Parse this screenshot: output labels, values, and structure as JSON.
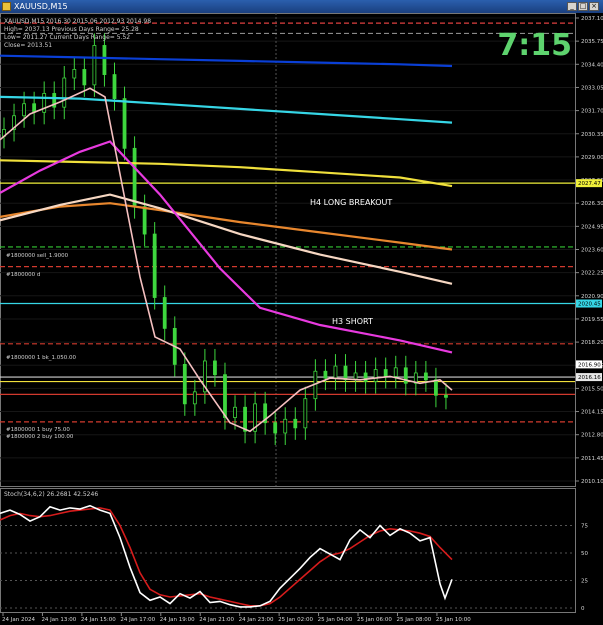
{
  "window": {
    "title": "XAUUSD,M15",
    "buttons": [
      "_",
      "□",
      "×"
    ]
  },
  "overlay": {
    "clock": "7:15",
    "info_lines": [
      "XAUUSD,M15 2016.30 2015.06 2012.93 2014.98",
      "High= 2037.13   Previous Days Range= 25.28",
      "Low= 2011.27   Current Days Range= 5.52",
      "Close= 2013.51"
    ]
  },
  "annotations": {
    "h4": "H4 LONG BREAKOUT",
    "h3": "H3 SHORT",
    "tags": [
      "#1800000 sell_1.9000",
      "#1800000 d",
      "#1800000 1 bk_1.050.00",
      "#1800000 1 buy 75.00",
      "#1800000 2 buy 100.00"
    ]
  },
  "price_axis": {
    "ticks": [
      "2037.10",
      "2035.75",
      "2034.40",
      "2033.05",
      "2031.70",
      "2030.35",
      "2029.00",
      "2027.65",
      "2026.30",
      "2024.95",
      "2023.60",
      "2022.25",
      "2020.90",
      "2019.55",
      "2018.20",
      "2016.85",
      "2015.50",
      "2014.15",
      "2012.80",
      "2011.45",
      "2010.10"
    ],
    "flags": {
      "h4": "2027.47",
      "h3": "2020.45",
      "current_a": "2016.16",
      "current_b": "2016.90"
    }
  },
  "stoch_axis": {
    "label": "Stoch(34,6,2) 26.2681 42.5246",
    "ticks": [
      "75",
      "50",
      "25",
      "0"
    ]
  },
  "time_axis": {
    "labels": [
      "24 Jan 2024",
      "24 Jan 13:00",
      "24 Jan 15:00",
      "24 Jan 17:00",
      "24 Jan 19:00",
      "24 Jan 21:00",
      "24 Jan 23:00",
      "25 Jan 02:00",
      "25 Jan 04:00",
      "25 Jan 06:00",
      "25 Jan 08:00",
      "25 Jan 10:00"
    ]
  },
  "chart_data": [
    {
      "type": "line",
      "title": "XAUUSD,M15",
      "ylim": [
        2010.1,
        2037.1
      ],
      "series": [
        {
          "color": "#0a3fd6",
          "x": [
            0,
            80,
            160,
            240,
            320,
            400,
            452
          ],
          "values": [
            2034.9,
            2034.8,
            2034.7,
            2034.6,
            2034.5,
            2034.4,
            2034.3
          ]
        },
        {
          "color": "#36d6e6",
          "x": [
            0,
            80,
            160,
            240,
            320,
            400,
            452
          ],
          "values": [
            2032.5,
            2032.4,
            2032.1,
            2031.8,
            2031.5,
            2031.2,
            2031.0
          ]
        },
        {
          "color": "#f0e03c",
          "x": [
            0,
            80,
            160,
            240,
            320,
            400,
            452
          ],
          "values": [
            2028.8,
            2028.7,
            2028.6,
            2028.4,
            2028.1,
            2027.8,
            2027.3
          ]
        },
        {
          "color": "#e8872e",
          "x": [
            0,
            60,
            110,
            160,
            240,
            320,
            400,
            452
          ],
          "values": [
            2025.5,
            2026.1,
            2026.3,
            2025.9,
            2025.2,
            2024.6,
            2024.0,
            2023.6
          ]
        },
        {
          "color": "#f6d7c2",
          "x": [
            0,
            60,
            110,
            160,
            240,
            320,
            400,
            452
          ],
          "values": [
            2025.3,
            2026.2,
            2026.8,
            2026.0,
            2024.5,
            2023.3,
            2022.3,
            2021.6
          ]
        },
        {
          "color": "#e83adf",
          "x": [
            0,
            40,
            80,
            110,
            160,
            220,
            260,
            320,
            400,
            452
          ],
          "values": [
            2026.9,
            2028.2,
            2029.3,
            2029.9,
            2026.8,
            2022.5,
            2020.2,
            2019.2,
            2018.3,
            2017.6
          ]
        },
        {
          "color": "#f5c0c0",
          "x": [
            0,
            30,
            60,
            90,
            105,
            120,
            140,
            155,
            180,
            200,
            230,
            250,
            270,
            300,
            330,
            360,
            390,
            420,
            440,
            452
          ],
          "values": [
            2030.0,
            2031.5,
            2032.2,
            2033.0,
            2032.5,
            2028.0,
            2022.0,
            2018.5,
            2017.8,
            2016.0,
            2013.5,
            2013.0,
            2013.9,
            2015.4,
            2016.1,
            2016.0,
            2016.2,
            2015.8,
            2016.0,
            2015.4
          ]
        }
      ],
      "candles_close": [
        2030.6,
        2031.4,
        2032.1,
        2031.6,
        2032.7,
        2031.9,
        2033.6,
        2034.1,
        2033.2,
        2035.5,
        2033.8,
        2032.4,
        2029.5,
        2026.1,
        2024.5,
        2020.8,
        2019.0,
        2016.9,
        2014.6,
        2015.3,
        2017.1,
        2016.3,
        2013.8,
        2014.4,
        2013.0,
        2014.6,
        2013.5,
        2012.9,
        2013.7,
        2013.2,
        2014.9,
        2016.5,
        2016.1,
        2016.8,
        2016.0,
        2016.4,
        2015.9,
        2016.6,
        2016.2,
        2016.7,
        2015.8,
        2016.4,
        2016.0,
        2015.1,
        2014.98
      ],
      "hlines": [
        {
          "price": 2036.8,
          "color": "#e04040",
          "style": "dash"
        },
        {
          "price": 2036.2,
          "color": "#8a8a8a",
          "style": "dash"
        },
        {
          "price": 2027.47,
          "color": "#f0f03a",
          "style": "solid"
        },
        {
          "price": 2023.75,
          "color": "#34c734",
          "style": "dash"
        },
        {
          "price": 2022.6,
          "color": "#d23a2e",
          "style": "dash"
        },
        {
          "price": 2020.45,
          "color": "#36d6e6",
          "style": "solid"
        },
        {
          "price": 2018.1,
          "color": "#d23a2e",
          "style": "dash"
        },
        {
          "price": 2016.16,
          "color": "#cfcfcf",
          "style": "solid"
        },
        {
          "price": 2015.9,
          "color": "#f0e03c",
          "style": "solid"
        },
        {
          "price": 2015.15,
          "color": "#d23a2e",
          "style": "solid"
        },
        {
          "price": 2013.55,
          "color": "#d23a2e",
          "style": "dash"
        }
      ]
    },
    {
      "type": "line",
      "title": "Stoch(34,6,2) 26.2681 42.5246",
      "ylim": [
        0,
        100
      ],
      "series": [
        {
          "color": "#ffffff",
          "x": [
            0,
            10,
            20,
            30,
            40,
            50,
            60,
            70,
            80,
            90,
            100,
            110,
            120,
            130,
            140,
            150,
            160,
            170,
            180,
            190,
            200,
            210,
            220,
            230,
            240,
            250,
            260,
            270,
            280,
            290,
            300,
            310,
            320,
            330,
            340,
            350,
            360,
            370,
            380,
            390,
            400,
            410,
            420,
            430,
            440,
            445,
            452
          ],
          "values": [
            86,
            89,
            85,
            79,
            83,
            92,
            89,
            91,
            90,
            93,
            89,
            86,
            64,
            37,
            14,
            7,
            10,
            4,
            13,
            9,
            15,
            5,
            6,
            3,
            1,
            1,
            2,
            6,
            18,
            27,
            36,
            46,
            54,
            49,
            44,
            62,
            71,
            64,
            75,
            66,
            72,
            68,
            61,
            64,
            22,
            9,
            26
          ]
        },
        {
          "color": "#d61c1c",
          "x": [
            0,
            10,
            20,
            30,
            40,
            50,
            60,
            70,
            80,
            90,
            100,
            110,
            120,
            130,
            140,
            150,
            160,
            170,
            180,
            190,
            200,
            210,
            220,
            230,
            240,
            250,
            260,
            270,
            280,
            290,
            300,
            310,
            320,
            330,
            340,
            350,
            360,
            370,
            380,
            390,
            400,
            410,
            420,
            430,
            440,
            452
          ],
          "values": [
            80,
            84,
            86,
            84,
            83,
            84,
            86,
            88,
            89,
            90,
            91,
            89,
            75,
            55,
            32,
            17,
            12,
            10,
            11,
            12,
            13,
            10,
            8,
            6,
            4,
            2,
            2,
            4,
            10,
            18,
            26,
            34,
            42,
            48,
            50,
            54,
            60,
            66,
            70,
            72,
            71,
            70,
            68,
            65,
            55,
            44
          ]
        }
      ]
    }
  ]
}
